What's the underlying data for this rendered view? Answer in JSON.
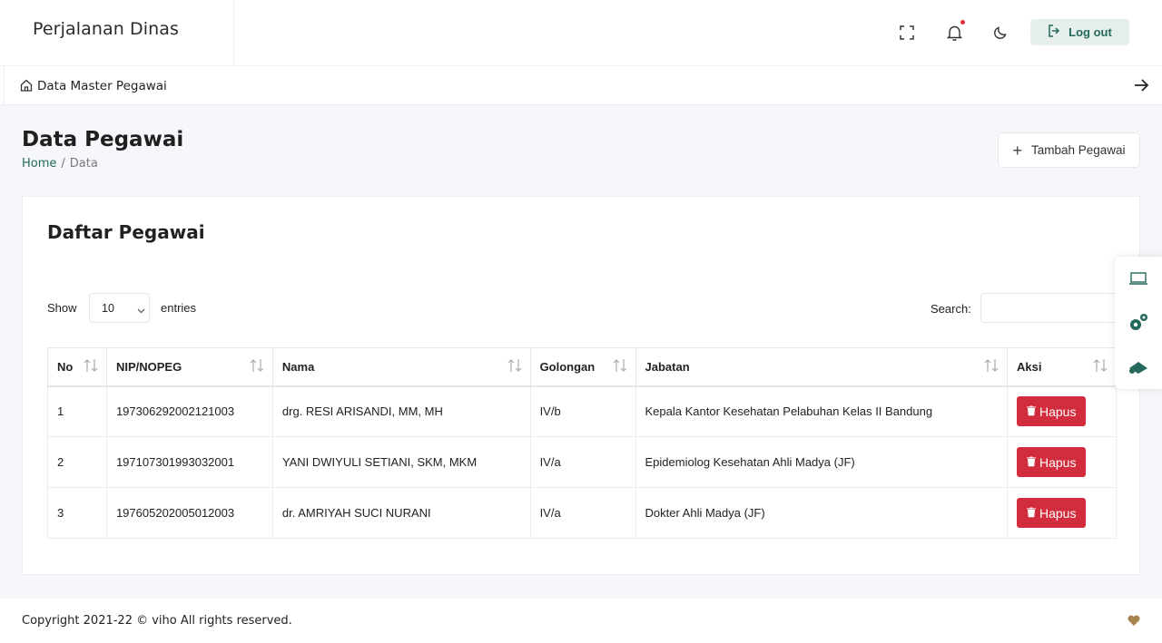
{
  "header": {
    "brand": "Perjalanan Dinas",
    "logout_label": "Log out"
  },
  "breadcrumb_bar": {
    "label": "Data Master Pegawai"
  },
  "page": {
    "title": "Data Pegawai",
    "breadcrumb_home": "Home",
    "breadcrumb_sep": "/",
    "breadcrumb_current": "Data",
    "add_button_label": "Tambah Pegawai"
  },
  "card": {
    "title": "Daftar Pegawai",
    "show_label": "Show",
    "entries_value": "10",
    "entries_label": "entries",
    "search_label": "Search:",
    "search_value": ""
  },
  "table": {
    "columns": [
      "No",
      "NIP/NOPEG",
      "Nama",
      "Golongan",
      "Jabatan",
      "Aksi"
    ],
    "rows": [
      {
        "no": "1",
        "nip": "197306292002121003",
        "nama": "drg. RESI ARISANDI, MM, MH",
        "golongan": "IV/b",
        "jabatan": "Kepala Kantor Kesehatan Pelabuhan Kelas II Bandung",
        "aksi": "Hapus"
      },
      {
        "no": "2",
        "nip": "197107301993032001",
        "nama": "YANI DWIYULI SETIANI, SKM, MKM",
        "golongan": "IV/a",
        "jabatan": "Epidemiolog Kesehatan Ahli Madya (JF)",
        "aksi": "Hapus"
      },
      {
        "no": "3",
        "nip": "197605202005012003",
        "nama": "dr. AMRIYAH SUCI NURANI",
        "golongan": "IV/a",
        "jabatan": "Dokter Ahli Madya (JF)",
        "aksi": "Hapus"
      }
    ]
  },
  "footer": {
    "copyright": "Copyright 2021-22 © viho All rights reserved."
  },
  "colors": {
    "primary": "#24695c",
    "danger": "#d22d3d",
    "background": "#f5f7fb"
  },
  "icons": {
    "header": [
      "fullscreen-icon",
      "bell-icon",
      "moon-icon",
      "logout-icon"
    ],
    "float": [
      "laptop-icon",
      "gears-icon",
      "box-icon"
    ]
  }
}
